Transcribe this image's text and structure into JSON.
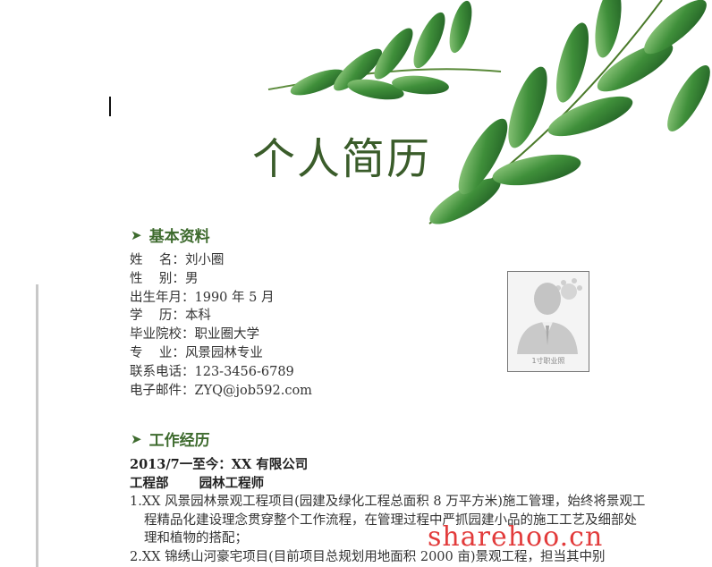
{
  "document": {
    "title": "个人简历",
    "sections": {
      "basic_info": {
        "heading": "基本资料",
        "rows": [
          {
            "label": "姓    名：",
            "value": "刘小圈"
          },
          {
            "label": "性    别：",
            "value": "男"
          },
          {
            "label": "出生年月：",
            "value": "1990 年 5 月"
          },
          {
            "label": "学    历：",
            "value": "本科"
          },
          {
            "label": "毕业院校：",
            "value": "职业圈大学"
          },
          {
            "label": "专    业：",
            "value": "风景园林专业"
          },
          {
            "label": "联系电话：",
            "value": "123-3456-6789"
          },
          {
            "label": "电子邮件：",
            "value": "ZYQ@job592.com"
          }
        ],
        "photo_caption": "1寸职业照"
      },
      "work": {
        "heading": "工作经历",
        "period": "2013/7一至今：XX 有限公司",
        "department": "工程部",
        "position": "园林工程师",
        "items": [
          "1.XX 风景园林景观工程项目(园建及绿化工程总面积 8 万平方米)施工管理，始终将景观工程精品化建设理念贯穿整个工作流程，在管理过程中严抓园建小品的施工工艺及细部处理和植物的搭配；",
          "2.XX 锦绣山河豪宅项目(目前项目总规划用地面积 2000 亩)景观工程，担当其中别"
        ]
      }
    },
    "watermark": "sharehoo.cn"
  },
  "colors": {
    "heading_green": "#3e6b2e",
    "title_green": "#3a5c2a",
    "watermark_red": "#e23b3b",
    "leaf_green": "#3f8f3a"
  }
}
